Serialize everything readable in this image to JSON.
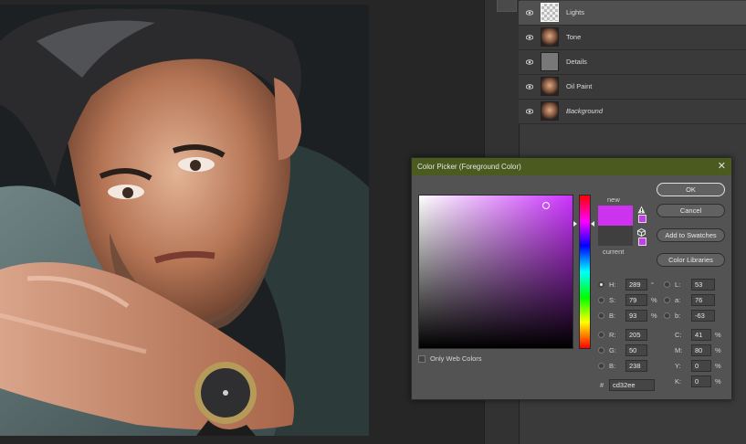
{
  "layers": {
    "rows": [
      {
        "name": "Lights",
        "thumb": "transparent",
        "selected": true,
        "italic": false
      },
      {
        "name": "Tone",
        "thumb": "portrait",
        "selected": false,
        "italic": false
      },
      {
        "name": "Details",
        "thumb": "gray",
        "selected": false,
        "italic": false
      },
      {
        "name": "Oil Paint",
        "thumb": "portrait",
        "selected": false,
        "italic": false
      },
      {
        "name": "Background",
        "thumb": "portrait",
        "selected": false,
        "italic": true
      }
    ],
    "visibility_icon": "eye-icon"
  },
  "picker": {
    "title": "Color Picker (Foreground Color)",
    "close_glyph": "✕",
    "new_label": "new",
    "current_label": "current",
    "new_color": "#cd32ee",
    "current_color": "#3f3f3f",
    "buttons": {
      "ok": "OK",
      "cancel": "Cancel",
      "add_swatches": "Add to Swatches",
      "libraries": "Color Libraries"
    },
    "fields": {
      "H": {
        "label": "H:",
        "value": "289",
        "unit": "°"
      },
      "S": {
        "label": "S:",
        "value": "79",
        "unit": "%"
      },
      "B": {
        "label": "B:",
        "value": "93",
        "unit": "%"
      },
      "R": {
        "label": "R:",
        "value": "205"
      },
      "G": {
        "label": "G:",
        "value": "50"
      },
      "Bb": {
        "label": "B:",
        "value": "238"
      },
      "L": {
        "label": "L:",
        "value": "53"
      },
      "a": {
        "label": "a:",
        "value": "76"
      },
      "b": {
        "label": "b:",
        "value": "-63"
      },
      "C": {
        "label": "C:",
        "value": "41",
        "unit": "%"
      },
      "M": {
        "label": "M:",
        "value": "80",
        "unit": "%"
      },
      "Y": {
        "label": "Y:",
        "value": "0",
        "unit": "%"
      },
      "K": {
        "label": "K:",
        "value": "0",
        "unit": "%"
      }
    },
    "hex_label": "#",
    "hex_value": "cd32ee",
    "only_web_colors": "Only Web Colors"
  },
  "colors": {
    "title_bar": "#4b5a1f",
    "panel": "#3a3a3a",
    "dialog": "#535353"
  }
}
